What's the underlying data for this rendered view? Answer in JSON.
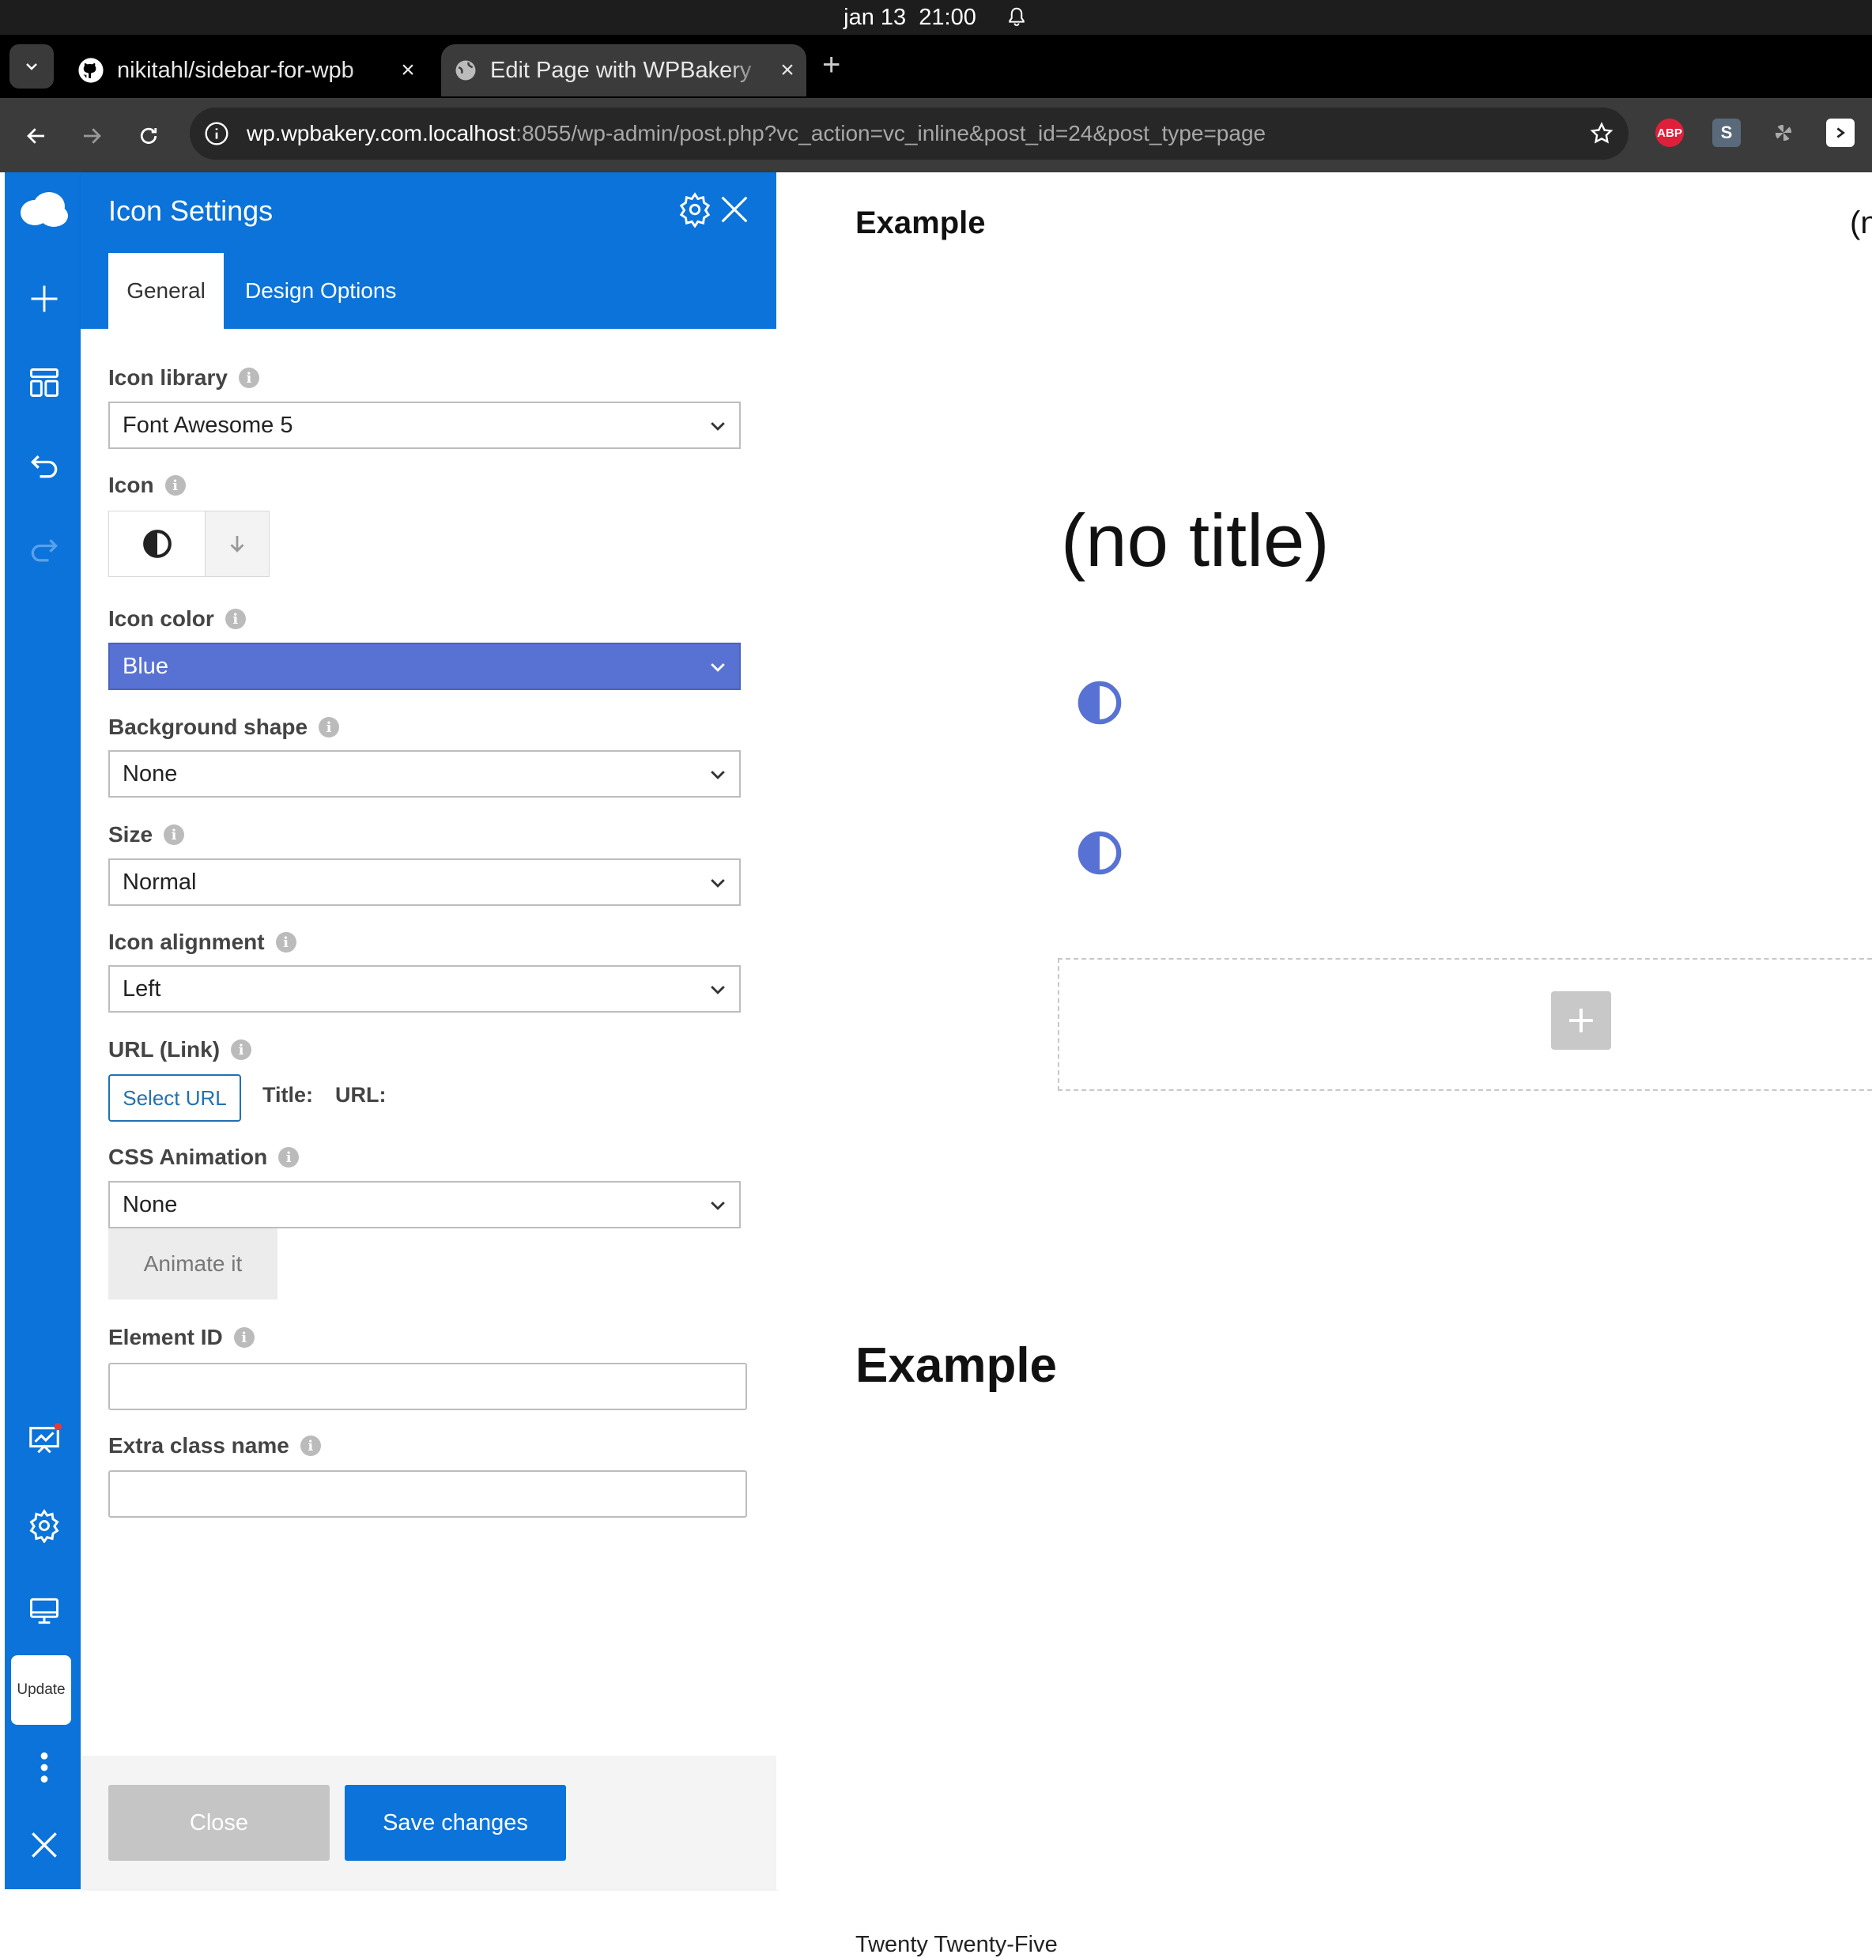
{
  "system": {
    "date": "jan 13",
    "time": "21:00"
  },
  "browser": {
    "tabs": [
      {
        "title": "nikitahl/sidebar-for-wpb",
        "close": "×",
        "active": false
      },
      {
        "title": "Edit Page with WPBakery",
        "close": "×",
        "active": true
      }
    ],
    "new_tab": "+",
    "url_host": "wp.wpbakery.com.localhost",
    "url_path": ":8055/wp-admin/post.php?vc_action=vc_inline&post_id=24&post_type=page",
    "extensions": [
      "ABP",
      "S"
    ]
  },
  "sidebar": {
    "update_label": "Update"
  },
  "panel": {
    "title": "Icon Settings",
    "tabs": {
      "general": "General",
      "design": "Design Options"
    },
    "fields": {
      "icon_library": {
        "label": "Icon library",
        "value": "Font Awesome 5"
      },
      "icon": {
        "label": "Icon"
      },
      "icon_color": {
        "label": "Icon color",
        "value": "Blue"
      },
      "background_shape": {
        "label": "Background shape",
        "value": "None"
      },
      "size": {
        "label": "Size",
        "value": "Normal"
      },
      "icon_alignment": {
        "label": "Icon alignment",
        "value": "Left"
      },
      "url": {
        "label": "URL (Link)",
        "button": "Select URL",
        "title_label": "Title:",
        "url_label": "URL:"
      },
      "css_animation": {
        "label": "CSS Animation",
        "value": "None",
        "animate_button": "Animate it"
      },
      "element_id": {
        "label": "Element ID",
        "value": ""
      },
      "extra_class": {
        "label": "Extra class name",
        "value": ""
      }
    },
    "footer": {
      "close": "Close",
      "save": "Save changes"
    }
  },
  "page": {
    "heading1": "Example",
    "cut_text": "(n",
    "no_title": "(no title)",
    "heading2": "Example",
    "footer_text": "Twenty Twenty-Five"
  },
  "colors": {
    "wp_blue": "#0b73d9",
    "icon_color_select": "#5872d4",
    "page_icon": "#5872d4"
  }
}
